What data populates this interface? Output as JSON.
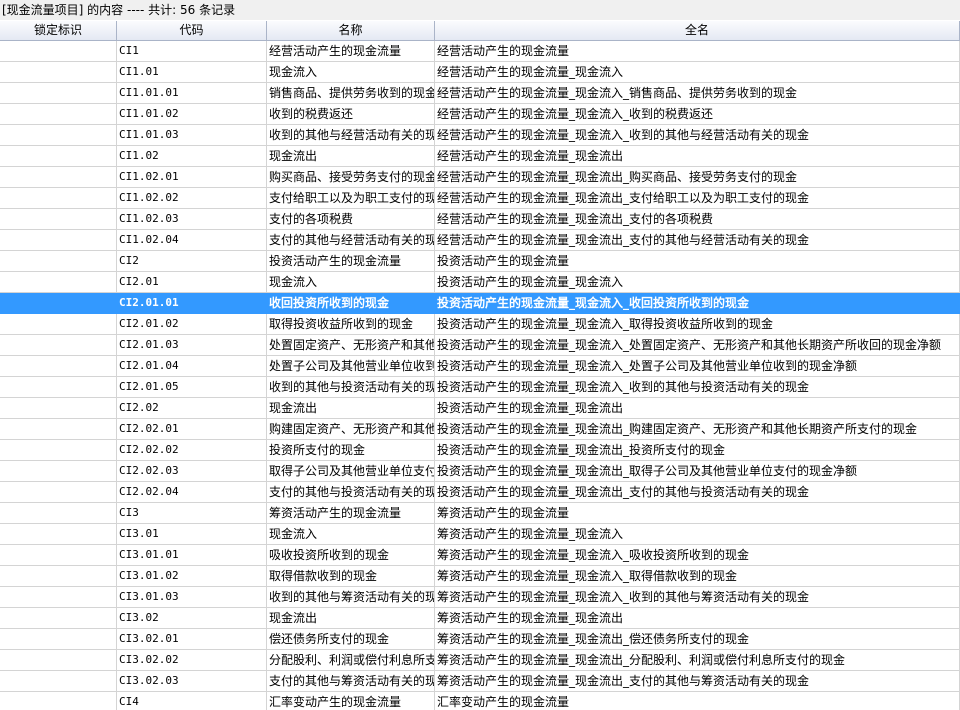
{
  "title": "[现金流量项目] 的内容 ---- 共计: 56 条记录",
  "columns": [
    "锁定标识",
    "代码",
    "名称",
    "全名"
  ],
  "selected_code": "CI2.01.01",
  "rows": [
    {
      "lock": "",
      "code": "CI1",
      "name": "经营活动产生的现金流量",
      "full": "经营活动产生的现金流量"
    },
    {
      "lock": "",
      "code": "CI1.01",
      "name": "现金流入",
      "full": "经营活动产生的现金流量_现金流入"
    },
    {
      "lock": "",
      "code": "CI1.01.01",
      "name": "销售商品、提供劳务收到的现金",
      "full": "经营活动产生的现金流量_现金流入_销售商品、提供劳务收到的现金"
    },
    {
      "lock": "",
      "code": "CI1.01.02",
      "name": "收到的税费返还",
      "full": "经营活动产生的现金流量_现金流入_收到的税费返还"
    },
    {
      "lock": "",
      "code": "CI1.01.03",
      "name": "收到的其他与经营活动有关的现金",
      "full": "经营活动产生的现金流量_现金流入_收到的其他与经营活动有关的现金"
    },
    {
      "lock": "",
      "code": "CI1.02",
      "name": "现金流出",
      "full": "经营活动产生的现金流量_现金流出"
    },
    {
      "lock": "",
      "code": "CI1.02.01",
      "name": "购买商品、接受劳务支付的现金",
      "full": "经营活动产生的现金流量_现金流出_购买商品、接受劳务支付的现金"
    },
    {
      "lock": "",
      "code": "CI1.02.02",
      "name": "支付给职工以及为职工支付的现金",
      "full": "经营活动产生的现金流量_现金流出_支付给职工以及为职工支付的现金"
    },
    {
      "lock": "",
      "code": "CI1.02.03",
      "name": "支付的各项税费",
      "full": "经营活动产生的现金流量_现金流出_支付的各项税费"
    },
    {
      "lock": "",
      "code": "CI1.02.04",
      "name": "支付的其他与经营活动有关的现金",
      "full": "经营活动产生的现金流量_现金流出_支付的其他与经营活动有关的现金"
    },
    {
      "lock": "",
      "code": "CI2",
      "name": "投资活动产生的现金流量",
      "full": "投资活动产生的现金流量"
    },
    {
      "lock": "",
      "code": "CI2.01",
      "name": "现金流入",
      "full": "投资活动产生的现金流量_现金流入"
    },
    {
      "lock": "",
      "code": "CI2.01.01",
      "name": "收回投资所收到的现金",
      "full": "投资活动产生的现金流量_现金流入_收回投资所收到的现金"
    },
    {
      "lock": "",
      "code": "CI2.01.02",
      "name": "取得投资收益所收到的现金",
      "full": "投资活动产生的现金流量_现金流入_取得投资收益所收到的现金"
    },
    {
      "lock": "",
      "code": "CI2.01.03",
      "name": "处置固定资产、无形资产和其他长期资产所收回的现金净额",
      "full": "投资活动产生的现金流量_现金流入_处置固定资产、无形资产和其他长期资产所收回的现金净额"
    },
    {
      "lock": "",
      "code": "CI2.01.04",
      "name": "处置子公司及其他营业单位收到的现金净额",
      "full": "投资活动产生的现金流量_现金流入_处置子公司及其他营业单位收到的现金净额"
    },
    {
      "lock": "",
      "code": "CI2.01.05",
      "name": "收到的其他与投资活动有关的现金",
      "full": "投资活动产生的现金流量_现金流入_收到的其他与投资活动有关的现金"
    },
    {
      "lock": "",
      "code": "CI2.02",
      "name": "现金流出",
      "full": "投资活动产生的现金流量_现金流出"
    },
    {
      "lock": "",
      "code": "CI2.02.01",
      "name": "购建固定资产、无形资产和其他长期资产所支付的现金",
      "full": "投资活动产生的现金流量_现金流出_购建固定资产、无形资产和其他长期资产所支付的现金"
    },
    {
      "lock": "",
      "code": "CI2.02.02",
      "name": "投资所支付的现金",
      "full": "投资活动产生的现金流量_现金流出_投资所支付的现金"
    },
    {
      "lock": "",
      "code": "CI2.02.03",
      "name": "取得子公司及其他营业单位支付的现金净额",
      "full": "投资活动产生的现金流量_现金流出_取得子公司及其他营业单位支付的现金净额"
    },
    {
      "lock": "",
      "code": "CI2.02.04",
      "name": "支付的其他与投资活动有关的现金",
      "full": "投资活动产生的现金流量_现金流出_支付的其他与投资活动有关的现金"
    },
    {
      "lock": "",
      "code": "CI3",
      "name": "筹资活动产生的现金流量",
      "full": "筹资活动产生的现金流量"
    },
    {
      "lock": "",
      "code": "CI3.01",
      "name": "现金流入",
      "full": "筹资活动产生的现金流量_现金流入"
    },
    {
      "lock": "",
      "code": "CI3.01.01",
      "name": "吸收投资所收到的现金",
      "full": "筹资活动产生的现金流量_现金流入_吸收投资所收到的现金"
    },
    {
      "lock": "",
      "code": "CI3.01.02",
      "name": "取得借款收到的现金",
      "full": "筹资活动产生的现金流量_现金流入_取得借款收到的现金"
    },
    {
      "lock": "",
      "code": "CI3.01.03",
      "name": "收到的其他与筹资活动有关的现金",
      "full": "筹资活动产生的现金流量_现金流入_收到的其他与筹资活动有关的现金"
    },
    {
      "lock": "",
      "code": "CI3.02",
      "name": "现金流出",
      "full": "筹资活动产生的现金流量_现金流出"
    },
    {
      "lock": "",
      "code": "CI3.02.01",
      "name": "偿还债务所支付的现金",
      "full": "筹资活动产生的现金流量_现金流出_偿还债务所支付的现金"
    },
    {
      "lock": "",
      "code": "CI3.02.02",
      "name": "分配股利、利润或偿付利息所支付的现金",
      "full": "筹资活动产生的现金流量_现金流出_分配股利、利润或偿付利息所支付的现金"
    },
    {
      "lock": "",
      "code": "CI3.02.03",
      "name": "支付的其他与筹资活动有关的现金",
      "full": "筹资活动产生的现金流量_现金流出_支付的其他与筹资活动有关的现金"
    },
    {
      "lock": "",
      "code": "CI4",
      "name": "汇率变动产生的现金流量",
      "full": "汇率变动产生的现金流量"
    }
  ]
}
